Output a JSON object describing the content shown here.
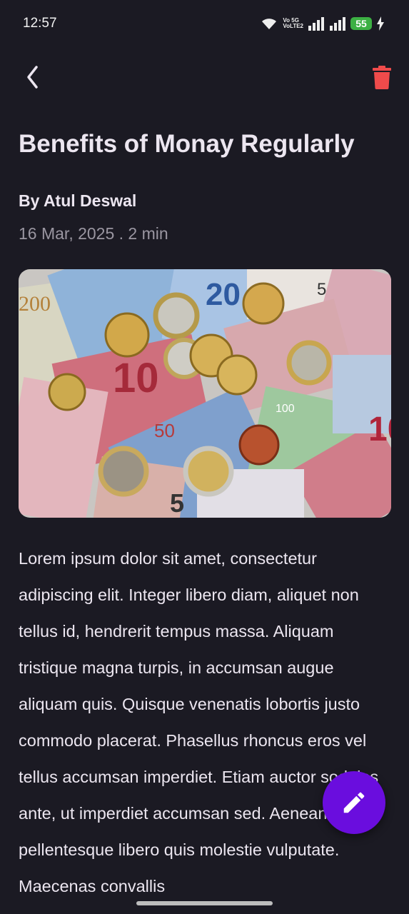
{
  "status_bar": {
    "time": "12:57",
    "network_label_top": "Vo 5G",
    "network_label_bottom": "VoLTE2",
    "battery": "55",
    "icons": [
      "wifi-icon",
      "signal-icon",
      "signal-icon",
      "battery-icon",
      "charging-icon"
    ]
  },
  "app_bar": {
    "back_icon": "chevron-left-icon",
    "delete_icon": "trash-icon",
    "delete_color": "#ef4b4b"
  },
  "article": {
    "title": "Benefits of Monay Regularly",
    "author": "By Atul Deswal",
    "meta": "16 Mar, 2025 . 2 min",
    "image_subject": "euro-banknotes-and-coins",
    "body": "Lorem ipsum dolor sit amet, consectetur adipiscing elit. Integer libero diam, aliquet non tellus id, hendrerit tempus massa. Aliquam tristique magna turpis, in accumsan augue aliquam quis. Quisque venenatis lobortis justo commodo placerat. Phasellus rhoncus eros vel tellus accumsan imperdiet. Etiam auctor sodales ante, ut imperdiet accumsan sed. Aenean pellentesque libero quis molestie vulputate. Maecenas convallis"
  },
  "fab": {
    "icon": "pencil-icon",
    "color": "#6a0dde"
  },
  "colors": {
    "background": "#1b1a23",
    "text": "#ece6f0",
    "muted": "#9a96a1"
  }
}
